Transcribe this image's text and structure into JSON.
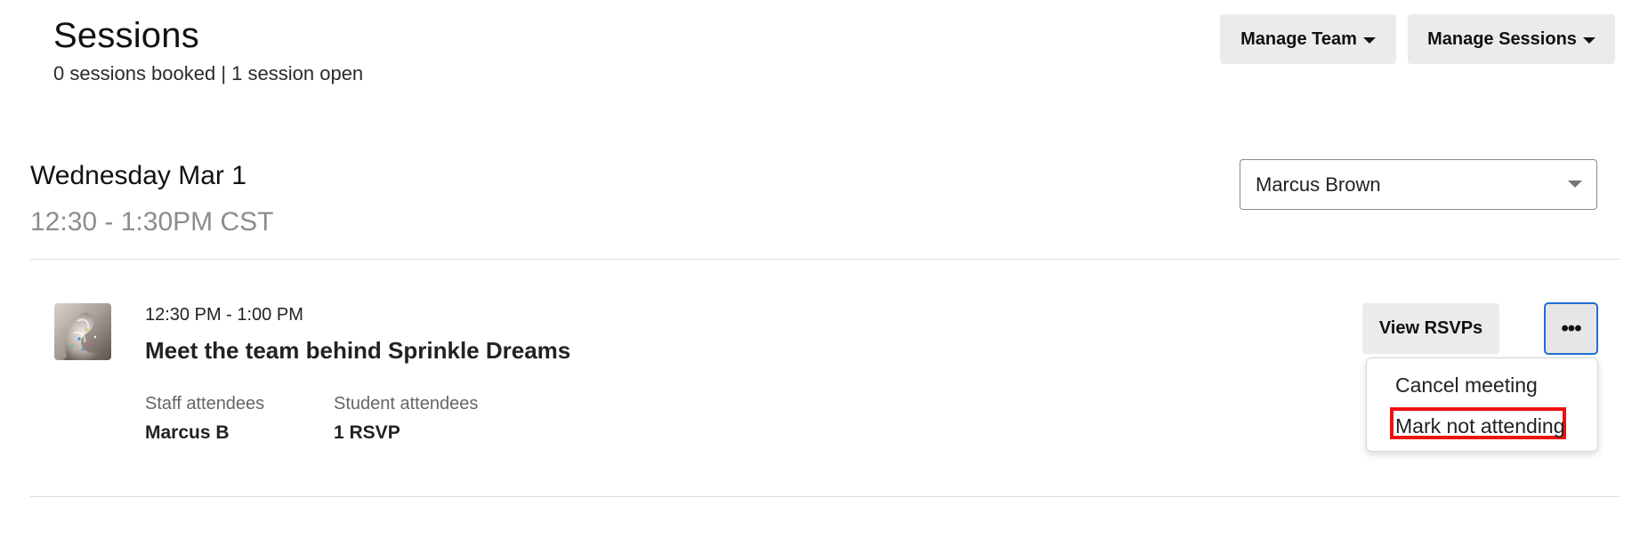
{
  "header": {
    "title": "Sessions",
    "summary": "0 sessions booked | 1 session open",
    "manage_team_label": "Manage Team",
    "manage_sessions_label": "Manage Sessions"
  },
  "day": {
    "date": "Wednesday Mar 1",
    "time_range": "12:30 - 1:30PM CST",
    "team_member_select": {
      "selected": "Marcus Brown"
    }
  },
  "session": {
    "time": "12:30 PM - 1:00 PM",
    "title": "Meet the team behind Sprinkle Dreams",
    "staff_label": "Staff attendees",
    "staff_value": "Marcus B",
    "student_label": "Student attendees",
    "student_value": "1 RSVP",
    "view_rsvps_label": "View RSVPs",
    "more_label": "•••",
    "thumbnail_icon": "sprinkle-donut-image"
  },
  "menu": {
    "items": [
      {
        "label": "Cancel meeting"
      },
      {
        "label": "Mark not attending"
      }
    ]
  },
  "colors": {
    "button_gray": "#ebebeb",
    "focus_blue": "#1f6fd1",
    "highlight_red": "#ee1111",
    "muted_text": "#8c8c8c"
  }
}
